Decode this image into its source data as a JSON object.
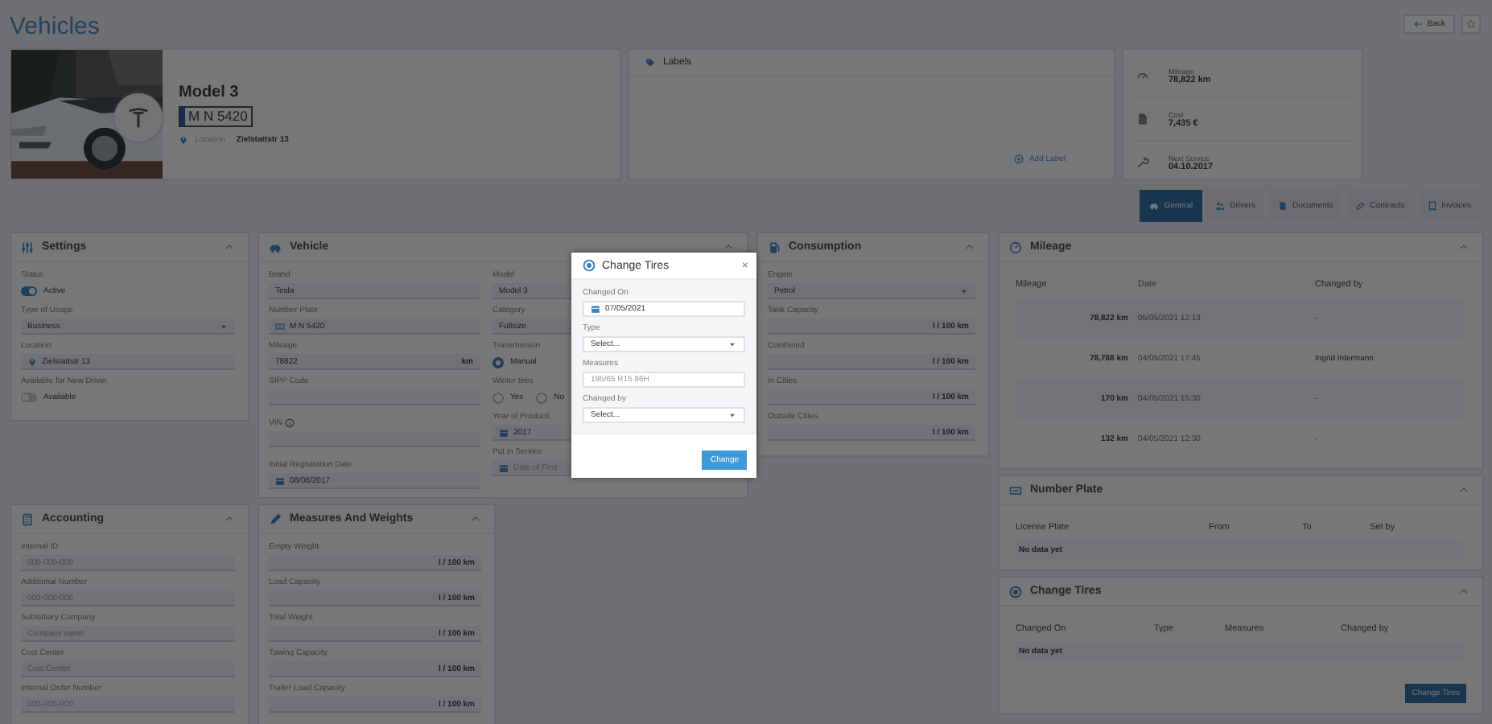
{
  "page": {
    "title": "Vehicles",
    "back_button": "Back"
  },
  "vehicle": {
    "model": "Model 3",
    "plate": "M N 5420",
    "location_label": "Location",
    "location": "Zielstattstr 13"
  },
  "labels": {
    "title": "Labels",
    "add_button": "Add Label"
  },
  "stats": [
    {
      "kind": "mileage",
      "label": "Mileage",
      "value": "78,822 km"
    },
    {
      "kind": "cost",
      "label": "Cost",
      "value": "7,435 €"
    },
    {
      "kind": "service",
      "label": "Next Service",
      "value": "04.10.2017"
    }
  ],
  "tabs": [
    {
      "kind": "general",
      "label": "General",
      "selected": true
    },
    {
      "kind": "drivers",
      "label": "Drivers",
      "selected": false
    },
    {
      "kind": "documents",
      "label": "Documents",
      "selected": false
    },
    {
      "kind": "contracts",
      "label": "Contracts",
      "selected": false
    },
    {
      "kind": "invoices",
      "label": "Invoices",
      "selected": false
    }
  ],
  "settings": {
    "title": "Settings",
    "fields": [
      {
        "kind": "toggle",
        "label": "Status",
        "on": true,
        "text": "Active"
      },
      {
        "kind": "select",
        "label": "Type of Usage",
        "value": "Business"
      },
      {
        "kind": "location",
        "label": "Location",
        "value": "Zielstattstr 13"
      },
      {
        "kind": "toggle",
        "label": "Available for New Driver",
        "on": false,
        "text": "Available"
      }
    ]
  },
  "vehicle_details": {
    "title": "Vehicle",
    "left": [
      {
        "kind": "text",
        "label": "Brand",
        "value": "Tesla"
      },
      {
        "kind": "plate",
        "label": "Number Plate",
        "value": "M N 5420"
      },
      {
        "kind": "text",
        "label": "Mileage",
        "value": "78822",
        "unit": "km"
      },
      {
        "kind": "text",
        "label": "SIPP Code"
      },
      {
        "kind": "text",
        "label": "VIN",
        "info": true
      },
      {
        "kind": "date",
        "label": "Initial Registration Date",
        "value": "08/06/2017"
      }
    ],
    "right": [
      {
        "kind": "text",
        "label": "Model",
        "value": "Model 3"
      },
      {
        "kind": "text",
        "label": "Category",
        "value": "Fullsize"
      },
      {
        "kind": "radio",
        "label": "Transmission",
        "options": [
          {
            "label": "Manual",
            "selected": true
          }
        ]
      },
      {
        "kind": "radio",
        "label": "Winter tires",
        "options": [
          {
            "label": "Yes",
            "selected": false
          },
          {
            "label": "No",
            "selected": false
          }
        ]
      },
      {
        "kind": "date",
        "label": "Year of Producti",
        "value": "2017"
      },
      {
        "kind": "date",
        "label": "Put in Service",
        "placeholder": "Date of First"
      }
    ]
  },
  "consumption": {
    "title": "Consumption",
    "fields": [
      {
        "kind": "select",
        "label": "Engine",
        "value": "Petrol"
      },
      {
        "kind": "text",
        "label": "Tank Capacity",
        "unit": "l / 100 km"
      },
      {
        "kind": "text",
        "label": "Combined",
        "unit": "l / 100 km"
      },
      {
        "kind": "text",
        "label": "In Cities",
        "unit": "l / 100 km"
      },
      {
        "kind": "text",
        "label": "Outside Cities",
        "unit": "l / 100 km"
      }
    ]
  },
  "mileage": {
    "title": "Mileage",
    "columns": [
      "Mileage",
      "Date",
      "Changed by"
    ],
    "rows": [
      [
        "78,822 km",
        "05/05/2021 12:13",
        "-"
      ],
      [
        "78,788 km",
        "04/05/2021 17:45",
        "Ingrid Intermann"
      ],
      [
        "170 km",
        "04/05/2021 15:30",
        "-"
      ],
      [
        "132 km",
        "04/05/2021 12:30",
        "-"
      ]
    ]
  },
  "number_plate": {
    "title": "Number Plate",
    "columns": [
      "License Plate",
      "From",
      "To",
      "Set by"
    ],
    "empty": "No data yet"
  },
  "change_tires": {
    "title": "Change Tires",
    "columns": [
      "Changed On",
      "Type",
      "Measures",
      "Changed by"
    ],
    "empty": "No data yet",
    "button": "Change Tires"
  },
  "accounting": {
    "title": "Accounting",
    "fields": [
      {
        "kind": "text",
        "label": "Internal ID",
        "placeholder": "000-000-000"
      },
      {
        "kind": "text",
        "label": "Additional Number",
        "placeholder": "000-000-000"
      },
      {
        "kind": "text",
        "label": "Subsidiary Company",
        "placeholder": "Company name"
      },
      {
        "kind": "text",
        "label": "Cost Center",
        "placeholder": "Cost Center"
      },
      {
        "kind": "text",
        "label": "Internal Order Number",
        "placeholder": "000-000-000"
      }
    ]
  },
  "measures": {
    "title": "Measures And Weights",
    "fields": [
      {
        "kind": "text",
        "label": "Empty Weight",
        "unit": "l / 100 km"
      },
      {
        "kind": "text",
        "label": "Load Capacity",
        "unit": "l / 100 km"
      },
      {
        "kind": "text",
        "label": "Total Weight",
        "unit": "l / 100 km"
      },
      {
        "kind": "text",
        "label": "Towing Capacity",
        "unit": "l / 100 km"
      },
      {
        "kind": "text",
        "label": "Trailer Load Capacity",
        "unit": "l / 100 km"
      }
    ]
  },
  "dialog": {
    "title": "Change Tires",
    "close": "×",
    "fields": [
      {
        "kind": "date",
        "label": "Changed On",
        "value": "07/05/2021"
      },
      {
        "kind": "select",
        "label": "Type",
        "value": "Select..."
      },
      {
        "kind": "text",
        "label": "Measures",
        "placeholder": "195/65 R15 86H"
      },
      {
        "kind": "select",
        "label": "Changed by",
        "value": "Select..."
      }
    ],
    "button": "Change"
  }
}
